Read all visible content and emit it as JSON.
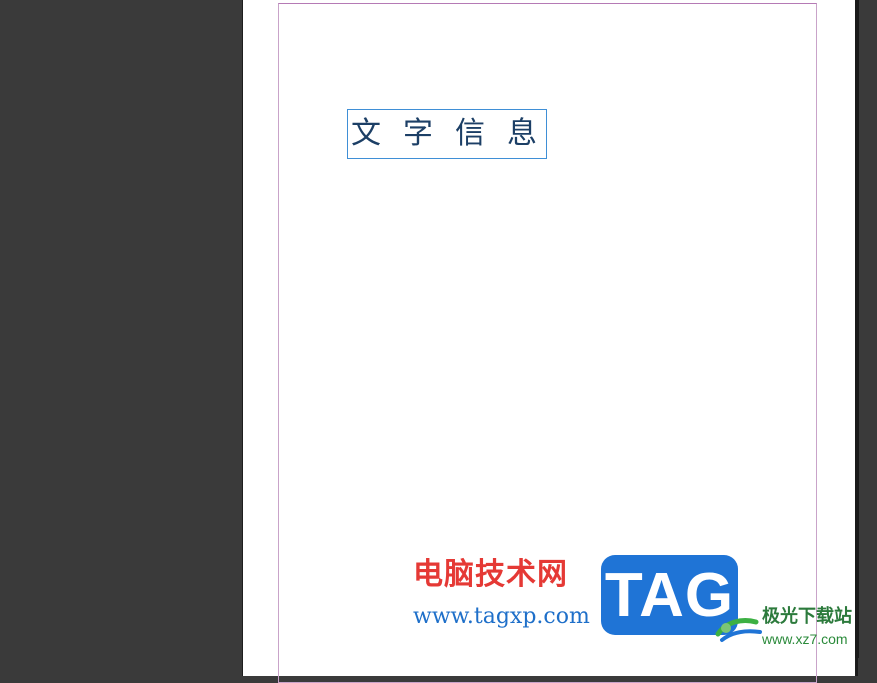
{
  "document": {
    "text_frame_content": "文字信息"
  },
  "watermark": {
    "site_name_cn": "电脑技术网",
    "site_url": "www.tagxp.com",
    "tag_logo_text": "TAG",
    "secondary_brand_cn": "极光下载站",
    "secondary_url": "www.xz7.com"
  },
  "colors": {
    "workspace_bg": "#3a3a3a",
    "page_bg": "#ffffff",
    "margin_guide": "#c9a3c9",
    "frame_border": "#3f8fd6",
    "frame_text": "#1c3f66",
    "watermark_red": "#e53935",
    "watermark_blue": "#1f74d6",
    "watermark_green": "#2c7a3c"
  }
}
